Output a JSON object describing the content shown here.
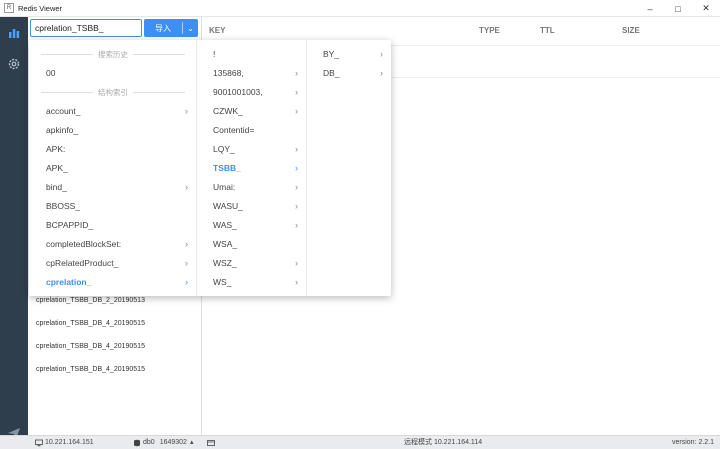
{
  "window": {
    "title": "Redis Viewer",
    "app_icon": "R",
    "minimize": "–",
    "maximize": "□",
    "close": "✕"
  },
  "search": {
    "value": "cprelation_TSBB_",
    "import_label": "导入",
    "dropdown_arrow": "⌄"
  },
  "columns": {
    "key": "KEY",
    "type": "TYPE",
    "ttl": "TTL",
    "size": "SIZE"
  },
  "cascader": {
    "history_title": "搜索历史",
    "history": [
      "00"
    ],
    "index_title": "结构索引",
    "level1": [
      {
        "label": "account_",
        "children": true
      },
      {
        "label": "apkinfo_",
        "children": false
      },
      {
        "label": "APK:",
        "children": false
      },
      {
        "label": "APK_",
        "children": false
      },
      {
        "label": "bind_",
        "children": true
      },
      {
        "label": "BBOSS_",
        "children": false
      },
      {
        "label": "BCPAPPID_",
        "children": false
      },
      {
        "label": "completedBlockSet:",
        "children": true
      },
      {
        "label": "cpRelatedProduct_",
        "children": true
      },
      {
        "label": "cprelation_",
        "children": true,
        "active": true
      }
    ],
    "level2": [
      {
        "label": "!",
        "children": false
      },
      {
        "label": "135868,",
        "children": true
      },
      {
        "label": "9001001003,",
        "children": true
      },
      {
        "label": "CZWK_",
        "children": true
      },
      {
        "label": "Contentid=",
        "children": false
      },
      {
        "label": "LQY_",
        "children": true
      },
      {
        "label": "TSBB_",
        "children": true,
        "active": true
      },
      {
        "label": "Umai:",
        "children": true
      },
      {
        "label": "WASU_",
        "children": true
      },
      {
        "label": "WAS_",
        "children": true
      },
      {
        "label": "WSA_",
        "children": false
      },
      {
        "label": "WSZ_",
        "children": true
      },
      {
        "label": "WS_",
        "children": true
      }
    ],
    "level3": [
      {
        "label": "BY_",
        "children": true
      },
      {
        "label": "DB_",
        "children": true
      }
    ]
  },
  "keys": [
    "cprelation_TSBB_DB_2_20190513",
    "cprelation_TSBB_DB_4_20190515",
    "cprelation_TSBB_DB_4_20190515",
    "cprelation_TSBB_DB_4_20190515"
  ],
  "status": {
    "host": "10.221.164.151",
    "db": "db0",
    "count": "1649302",
    "count_arrow": "▴",
    "mode": "远程模式 10.221.164.114",
    "version": "version: 2.2.1"
  },
  "colors": {
    "accent": "#3d8ff6",
    "rail": "#2f3e4d",
    "statusbar": "#e9ebee"
  },
  "icons": {
    "rail_top": "bar-chart-icon",
    "rail_settings": "gear-icon",
    "rail_bottom": "send-icon"
  }
}
